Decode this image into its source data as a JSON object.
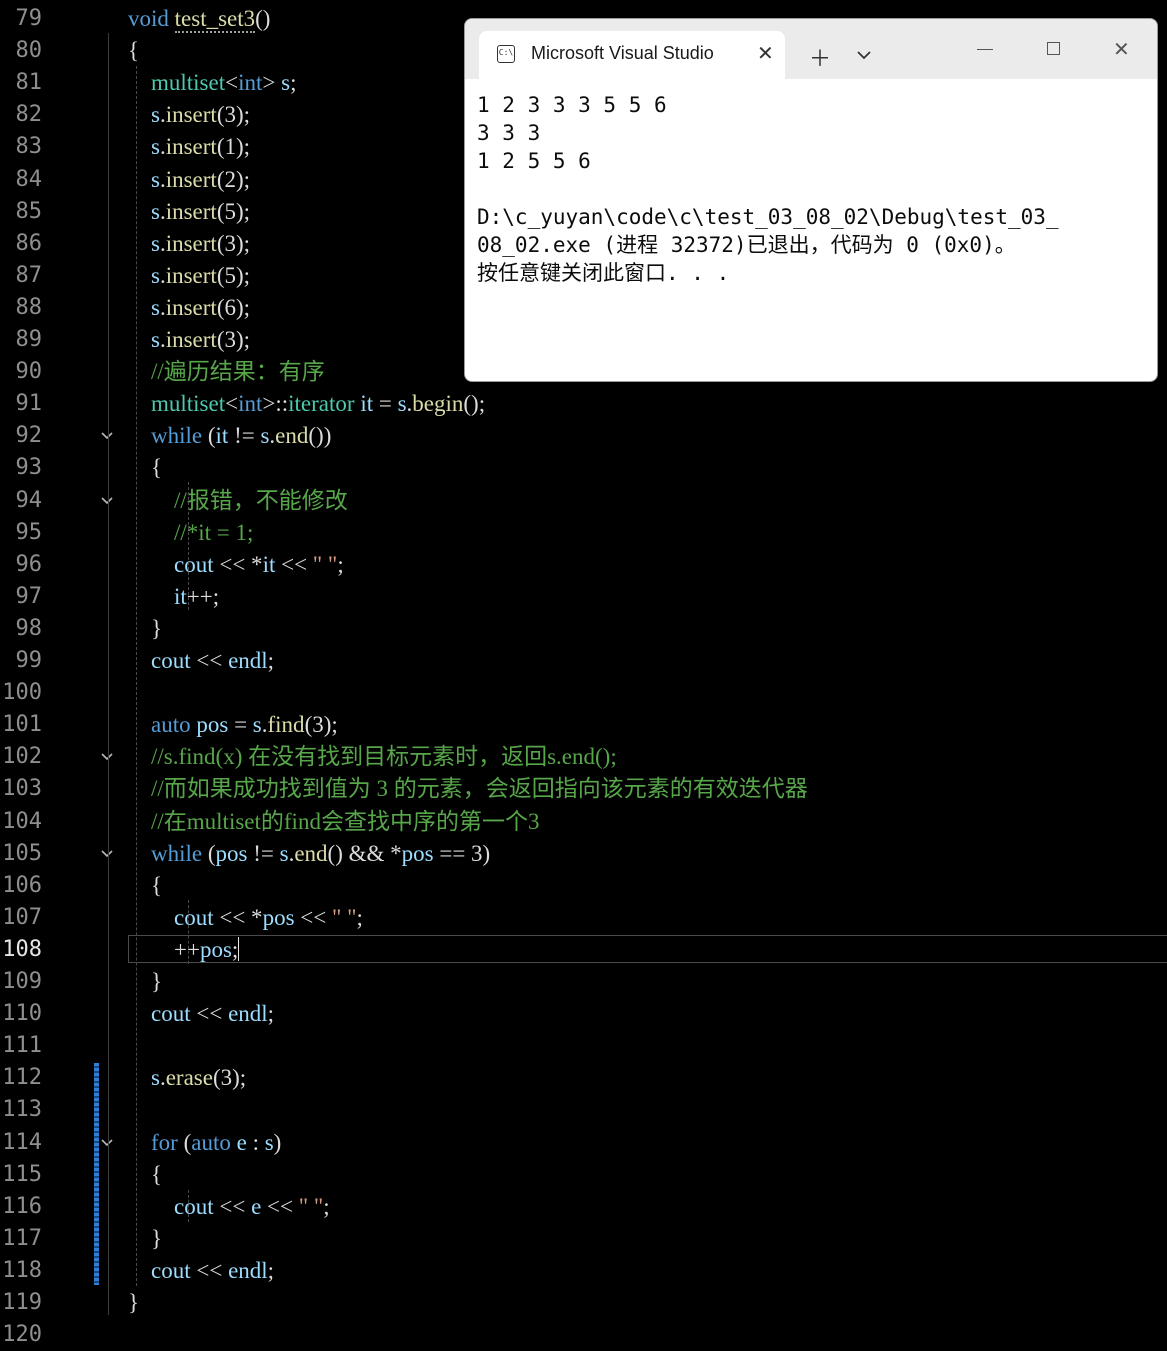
{
  "editor": {
    "current_line": 108,
    "lines": [
      {
        "n": "79",
        "tokens": [
          {
            "c": "kw",
            "t": "void"
          },
          {
            "c": "plain",
            "t": " "
          },
          {
            "c": "fn",
            "t": "test_set3",
            "sq": true
          },
          {
            "c": "plain",
            "t": "()"
          }
        ]
      },
      {
        "n": "80",
        "tokens": [
          {
            "c": "plain",
            "t": "{"
          }
        ]
      },
      {
        "n": "81",
        "tokens": [
          {
            "c": "plain",
            "t": "    "
          },
          {
            "c": "ty",
            "t": "multiset"
          },
          {
            "c": "plain",
            "t": "<"
          },
          {
            "c": "kw",
            "t": "int"
          },
          {
            "c": "plain",
            "t": "> "
          },
          {
            "c": "var",
            "t": "s"
          },
          {
            "c": "plain",
            "t": ";"
          }
        ]
      },
      {
        "n": "82",
        "tokens": [
          {
            "c": "plain",
            "t": "    "
          },
          {
            "c": "var",
            "t": "s"
          },
          {
            "c": "plain",
            "t": "."
          },
          {
            "c": "fn",
            "t": "insert"
          },
          {
            "c": "plain",
            "t": "(3);"
          }
        ]
      },
      {
        "n": "83",
        "tokens": [
          {
            "c": "plain",
            "t": "    "
          },
          {
            "c": "var",
            "t": "s"
          },
          {
            "c": "plain",
            "t": "."
          },
          {
            "c": "fn",
            "t": "insert"
          },
          {
            "c": "plain",
            "t": "(1);"
          }
        ]
      },
      {
        "n": "84",
        "tokens": [
          {
            "c": "plain",
            "t": "    "
          },
          {
            "c": "var",
            "t": "s"
          },
          {
            "c": "plain",
            "t": "."
          },
          {
            "c": "fn",
            "t": "insert"
          },
          {
            "c": "plain",
            "t": "(2);"
          }
        ]
      },
      {
        "n": "85",
        "tokens": [
          {
            "c": "plain",
            "t": "    "
          },
          {
            "c": "var",
            "t": "s"
          },
          {
            "c": "plain",
            "t": "."
          },
          {
            "c": "fn",
            "t": "insert"
          },
          {
            "c": "plain",
            "t": "(5);"
          }
        ]
      },
      {
        "n": "86",
        "tokens": [
          {
            "c": "plain",
            "t": "    "
          },
          {
            "c": "var",
            "t": "s"
          },
          {
            "c": "plain",
            "t": "."
          },
          {
            "c": "fn",
            "t": "insert"
          },
          {
            "c": "plain",
            "t": "(3);"
          }
        ]
      },
      {
        "n": "87",
        "tokens": [
          {
            "c": "plain",
            "t": "    "
          },
          {
            "c": "var",
            "t": "s"
          },
          {
            "c": "plain",
            "t": "."
          },
          {
            "c": "fn",
            "t": "insert"
          },
          {
            "c": "plain",
            "t": "(5);"
          }
        ]
      },
      {
        "n": "88",
        "tokens": [
          {
            "c": "plain",
            "t": "    "
          },
          {
            "c": "var",
            "t": "s"
          },
          {
            "c": "plain",
            "t": "."
          },
          {
            "c": "fn",
            "t": "insert"
          },
          {
            "c": "plain",
            "t": "(6);"
          }
        ]
      },
      {
        "n": "89",
        "tokens": [
          {
            "c": "plain",
            "t": "    "
          },
          {
            "c": "var",
            "t": "s"
          },
          {
            "c": "plain",
            "t": "."
          },
          {
            "c": "fn",
            "t": "insert"
          },
          {
            "c": "plain",
            "t": "(3);"
          }
        ]
      },
      {
        "n": "90",
        "tokens": [
          {
            "c": "plain",
            "t": "    "
          },
          {
            "c": "cm",
            "t": "//遍历结果：有序"
          }
        ]
      },
      {
        "n": "91",
        "tokens": [
          {
            "c": "plain",
            "t": "    "
          },
          {
            "c": "ty",
            "t": "multiset"
          },
          {
            "c": "plain",
            "t": "<"
          },
          {
            "c": "kw",
            "t": "int"
          },
          {
            "c": "plain",
            "t": ">::"
          },
          {
            "c": "ty",
            "t": "iterator"
          },
          {
            "c": "plain",
            "t": " "
          },
          {
            "c": "var",
            "t": "it"
          },
          {
            "c": "plain",
            "t": " = "
          },
          {
            "c": "var",
            "t": "s"
          },
          {
            "c": "plain",
            "t": "."
          },
          {
            "c": "fn",
            "t": "begin"
          },
          {
            "c": "plain",
            "t": "();"
          }
        ]
      },
      {
        "n": "92",
        "fold": true,
        "tokens": [
          {
            "c": "plain",
            "t": "    "
          },
          {
            "c": "kw",
            "t": "while"
          },
          {
            "c": "plain",
            "t": " ("
          },
          {
            "c": "var",
            "t": "it"
          },
          {
            "c": "plain",
            "t": " != "
          },
          {
            "c": "var",
            "t": "s"
          },
          {
            "c": "plain",
            "t": "."
          },
          {
            "c": "fn",
            "t": "end"
          },
          {
            "c": "plain",
            "t": "())"
          }
        ]
      },
      {
        "n": "93",
        "tokens": [
          {
            "c": "plain",
            "t": "    {"
          }
        ]
      },
      {
        "n": "94",
        "fold": true,
        "tokens": [
          {
            "c": "plain",
            "t": "        "
          },
          {
            "c": "cm",
            "t": "//报错，不能修改"
          }
        ]
      },
      {
        "n": "95",
        "tokens": [
          {
            "c": "plain",
            "t": "        "
          },
          {
            "c": "cm",
            "t": "//*it = 1;"
          }
        ]
      },
      {
        "n": "96",
        "tokens": [
          {
            "c": "plain",
            "t": "        "
          },
          {
            "c": "var",
            "t": "cout"
          },
          {
            "c": "plain",
            "t": " << *"
          },
          {
            "c": "var",
            "t": "it"
          },
          {
            "c": "plain",
            "t": " << "
          },
          {
            "c": "st",
            "t": "\" \""
          },
          {
            "c": "plain",
            "t": ";"
          }
        ]
      },
      {
        "n": "97",
        "tokens": [
          {
            "c": "plain",
            "t": "        "
          },
          {
            "c": "var",
            "t": "it"
          },
          {
            "c": "plain",
            "t": "++;"
          }
        ]
      },
      {
        "n": "98",
        "tokens": [
          {
            "c": "plain",
            "t": "    }"
          }
        ]
      },
      {
        "n": "99",
        "tokens": [
          {
            "c": "plain",
            "t": "    "
          },
          {
            "c": "var",
            "t": "cout"
          },
          {
            "c": "plain",
            "t": " << "
          },
          {
            "c": "var",
            "t": "endl"
          },
          {
            "c": "plain",
            "t": ";"
          }
        ]
      },
      {
        "n": "100",
        "tokens": []
      },
      {
        "n": "101",
        "tokens": [
          {
            "c": "plain",
            "t": "    "
          },
          {
            "c": "kw",
            "t": "auto"
          },
          {
            "c": "plain",
            "t": " "
          },
          {
            "c": "var",
            "t": "pos"
          },
          {
            "c": "plain",
            "t": " = "
          },
          {
            "c": "var",
            "t": "s"
          },
          {
            "c": "plain",
            "t": "."
          },
          {
            "c": "fn",
            "t": "find"
          },
          {
            "c": "plain",
            "t": "(3);"
          }
        ]
      },
      {
        "n": "102",
        "fold": true,
        "tokens": [
          {
            "c": "plain",
            "t": "    "
          },
          {
            "c": "cm",
            "t": "//s.find(x) 在没有找到目标元素时，返回s.end();"
          }
        ]
      },
      {
        "n": "103",
        "tokens": [
          {
            "c": "plain",
            "t": "    "
          },
          {
            "c": "cm",
            "t": "//而如果成功找到值为 3 的元素，会返回指向该元素的有效迭代器"
          }
        ]
      },
      {
        "n": "104",
        "tokens": [
          {
            "c": "plain",
            "t": "    "
          },
          {
            "c": "cm",
            "t": "//在multiset的find会查找中序的第一个3"
          }
        ]
      },
      {
        "n": "105",
        "fold": true,
        "tokens": [
          {
            "c": "plain",
            "t": "    "
          },
          {
            "c": "kw",
            "t": "while"
          },
          {
            "c": "plain",
            "t": " ("
          },
          {
            "c": "var",
            "t": "pos"
          },
          {
            "c": "plain",
            "t": " != "
          },
          {
            "c": "var",
            "t": "s"
          },
          {
            "c": "plain",
            "t": "."
          },
          {
            "c": "fn",
            "t": "end"
          },
          {
            "c": "plain",
            "t": "() && *"
          },
          {
            "c": "var",
            "t": "pos"
          },
          {
            "c": "plain",
            "t": " == 3)"
          }
        ]
      },
      {
        "n": "106",
        "tokens": [
          {
            "c": "plain",
            "t": "    {"
          }
        ]
      },
      {
        "n": "107",
        "tokens": [
          {
            "c": "plain",
            "t": "        "
          },
          {
            "c": "var",
            "t": "cout"
          },
          {
            "c": "plain",
            "t": " << *"
          },
          {
            "c": "var",
            "t": "pos"
          },
          {
            "c": "plain",
            "t": " << "
          },
          {
            "c": "st",
            "t": "\" \""
          },
          {
            "c": "plain",
            "t": ";"
          }
        ]
      },
      {
        "n": "108",
        "caret": true,
        "tokens": [
          {
            "c": "plain",
            "t": "        ++"
          },
          {
            "c": "var",
            "t": "pos"
          },
          {
            "c": "plain",
            "t": ";"
          }
        ]
      },
      {
        "n": "109",
        "tokens": [
          {
            "c": "plain",
            "t": "    }"
          }
        ]
      },
      {
        "n": "110",
        "tokens": [
          {
            "c": "plain",
            "t": "    "
          },
          {
            "c": "var",
            "t": "cout"
          },
          {
            "c": "plain",
            "t": " << "
          },
          {
            "c": "var",
            "t": "endl"
          },
          {
            "c": "plain",
            "t": ";"
          }
        ]
      },
      {
        "n": "111",
        "tokens": []
      },
      {
        "n": "112",
        "tokens": [
          {
            "c": "plain",
            "t": "    "
          },
          {
            "c": "var",
            "t": "s"
          },
          {
            "c": "plain",
            "t": "."
          },
          {
            "c": "fn",
            "t": "erase"
          },
          {
            "c": "plain",
            "t": "(3);"
          }
        ]
      },
      {
        "n": "113",
        "tokens": []
      },
      {
        "n": "114",
        "fold": true,
        "tokens": [
          {
            "c": "plain",
            "t": "    "
          },
          {
            "c": "kw",
            "t": "for"
          },
          {
            "c": "plain",
            "t": " ("
          },
          {
            "c": "kw",
            "t": "auto"
          },
          {
            "c": "plain",
            "t": " "
          },
          {
            "c": "var",
            "t": "e"
          },
          {
            "c": "plain",
            "t": " : "
          },
          {
            "c": "var",
            "t": "s"
          },
          {
            "c": "plain",
            "t": ")"
          }
        ]
      },
      {
        "n": "115",
        "tokens": [
          {
            "c": "plain",
            "t": "    {"
          }
        ]
      },
      {
        "n": "116",
        "tokens": [
          {
            "c": "plain",
            "t": "        "
          },
          {
            "c": "var",
            "t": "cout"
          },
          {
            "c": "plain",
            "t": " << "
          },
          {
            "c": "var",
            "t": "e"
          },
          {
            "c": "plain",
            "t": " << "
          },
          {
            "c": "st",
            "t": "\" \""
          },
          {
            "c": "plain",
            "t": ";"
          }
        ]
      },
      {
        "n": "117",
        "tokens": [
          {
            "c": "plain",
            "t": "    }"
          }
        ]
      },
      {
        "n": "118",
        "tokens": [
          {
            "c": "plain",
            "t": "    "
          },
          {
            "c": "var",
            "t": "cout"
          },
          {
            "c": "plain",
            "t": " << "
          },
          {
            "c": "var",
            "t": "endl"
          },
          {
            "c": "plain",
            "t": ";"
          }
        ]
      },
      {
        "n": "119",
        "tokens": [
          {
            "c": "plain",
            "t": "}"
          }
        ]
      },
      {
        "n": "120",
        "tokens": []
      }
    ]
  },
  "console": {
    "tab_title": "Microsoft Visual Studio",
    "tab_icon_glyph": "C:\\",
    "icons": {
      "tab_close": "close-icon",
      "new_tab": "plus-icon",
      "dropdown": "chevron-down-icon",
      "minimize": "minimize-icon",
      "maximize": "maximize-icon",
      "close": "close-icon"
    },
    "output_lines": [
      "1 2 3 3 3 5 5 6",
      "3 3 3",
      "1 2 5 5 6",
      "",
      "D:\\c_yuyan\\code\\c\\test_03_08_02\\Debug\\test_03_",
      "08_02.exe (进程 32372)已退出，代码为 0 (0x0)。",
      "按任意键关闭此窗口. . ."
    ]
  },
  "colors": {
    "background": "#000000",
    "keyword": "#569cd6",
    "type": "#4ec9b0",
    "variable": "#9cdcfe",
    "comment": "#57a64a",
    "string": "#d69d85",
    "function": "#dcdcaa"
  }
}
